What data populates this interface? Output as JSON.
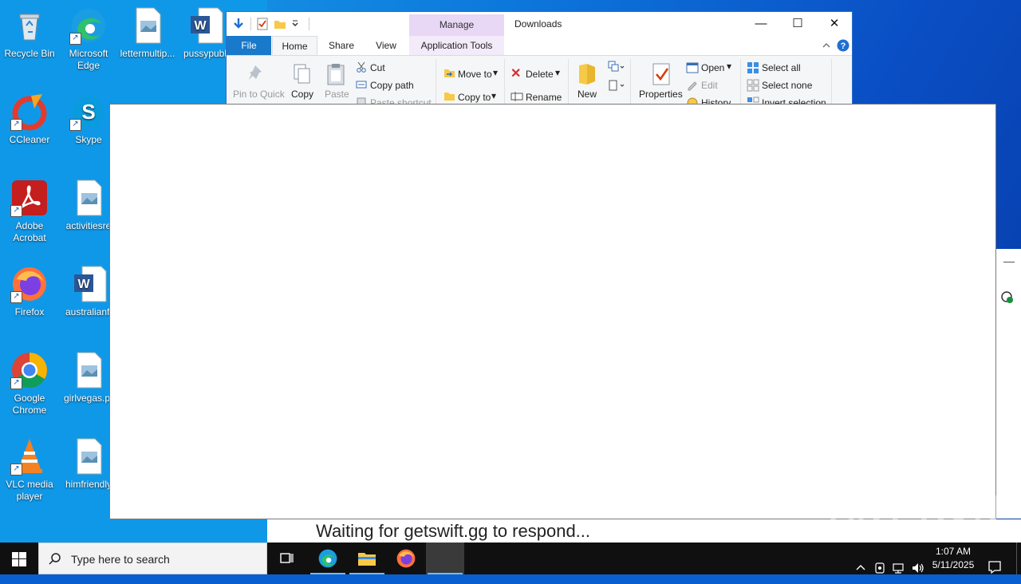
{
  "desktop": {
    "icons": [
      {
        "label": "Recycle Bin"
      },
      {
        "label": "Microsoft Edge"
      },
      {
        "label": "lettermultip..."
      },
      {
        "label": "pussypubl"
      },
      {
        "label": "CCleaner"
      },
      {
        "label": "Skype"
      },
      {
        "label": "Adobe Acrobat"
      },
      {
        "label": "activitiesre"
      },
      {
        "label": "Firefox"
      },
      {
        "label": "australianfi"
      },
      {
        "label": "Google Chrome"
      },
      {
        "label": "girlvegas.pr"
      },
      {
        "label": "VLC media player"
      },
      {
        "label": "himfriendly"
      }
    ]
  },
  "explorer": {
    "title": "Downloads",
    "manage_label": "Manage",
    "tabs": {
      "file": "File",
      "home": "Home",
      "share": "Share",
      "view": "View",
      "app_tools": "Application Tools"
    },
    "ribbon": {
      "pin": "Pin to Quick",
      "copy": "Copy",
      "paste": "Paste",
      "cut": "Cut",
      "copy_path": "Copy path",
      "paste_shortcut": "Paste shortcut",
      "move_to": "Move to",
      "copy_to": "Copy to",
      "delete": "Delete",
      "rename": "Rename",
      "new_folder": "New",
      "properties": "Properties",
      "open": "Open",
      "edit": "Edit",
      "history": "History",
      "select_all": "Select all",
      "select_none": "Select none",
      "invert_selection": "Invert selection"
    },
    "accent": "#1979ca"
  },
  "browser": {
    "status": "Waiting for getswift.gg to respond..."
  },
  "watermark": "ANY RUN",
  "taskbar": {
    "search_placeholder": "Type here to search",
    "time": "1:07 AM",
    "date": "5/11/2025"
  }
}
